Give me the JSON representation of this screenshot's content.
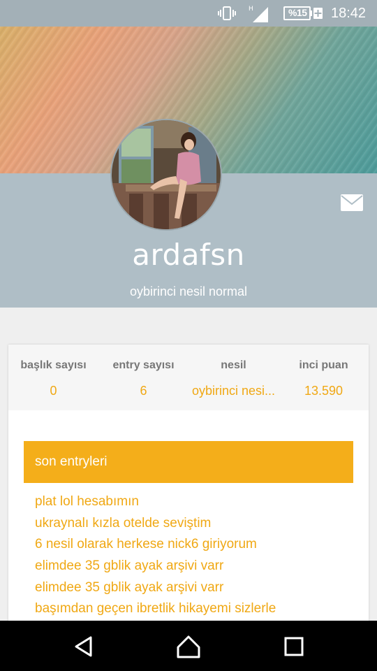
{
  "status_bar": {
    "network_label": "H",
    "battery_text": "%15",
    "battery_plus": "+",
    "clock": "18:42"
  },
  "profile": {
    "username": "ardafsn",
    "subtitle": "oybirinci nesil normal",
    "avatar_icon": "profile-photo",
    "message_icon": "envelope-icon"
  },
  "stats": [
    {
      "label": "başlık sayısı",
      "value": "0"
    },
    {
      "label": "entry sayısı",
      "value": "6"
    },
    {
      "label": "nesil",
      "value": "oybirinci nesi..."
    },
    {
      "label": "inci puan",
      "value": "13.590"
    }
  ],
  "recent_entries": {
    "header": "son entryleri",
    "items": [
      "plat lol hesabımın",
      "ukraynalı kızla otelde seviştim",
      "6 nesil olarak herkese nick6 giriyorum",
      "elimdee 35 gblik ayak arşivi varr",
      "elimdee 35 gblik ayak arşivi varr",
      "başımdan geçen ibretlik hikayemi sizlerle"
    ]
  },
  "nav": {
    "back_icon": "back-triangle-icon",
    "home_icon": "home-icon",
    "recents_icon": "recents-square-icon"
  },
  "colors": {
    "accent": "#f4ae1a",
    "accent_text": "#f0a814",
    "profile_band": "#afbec6",
    "status_bar": "#a3b0b7"
  }
}
